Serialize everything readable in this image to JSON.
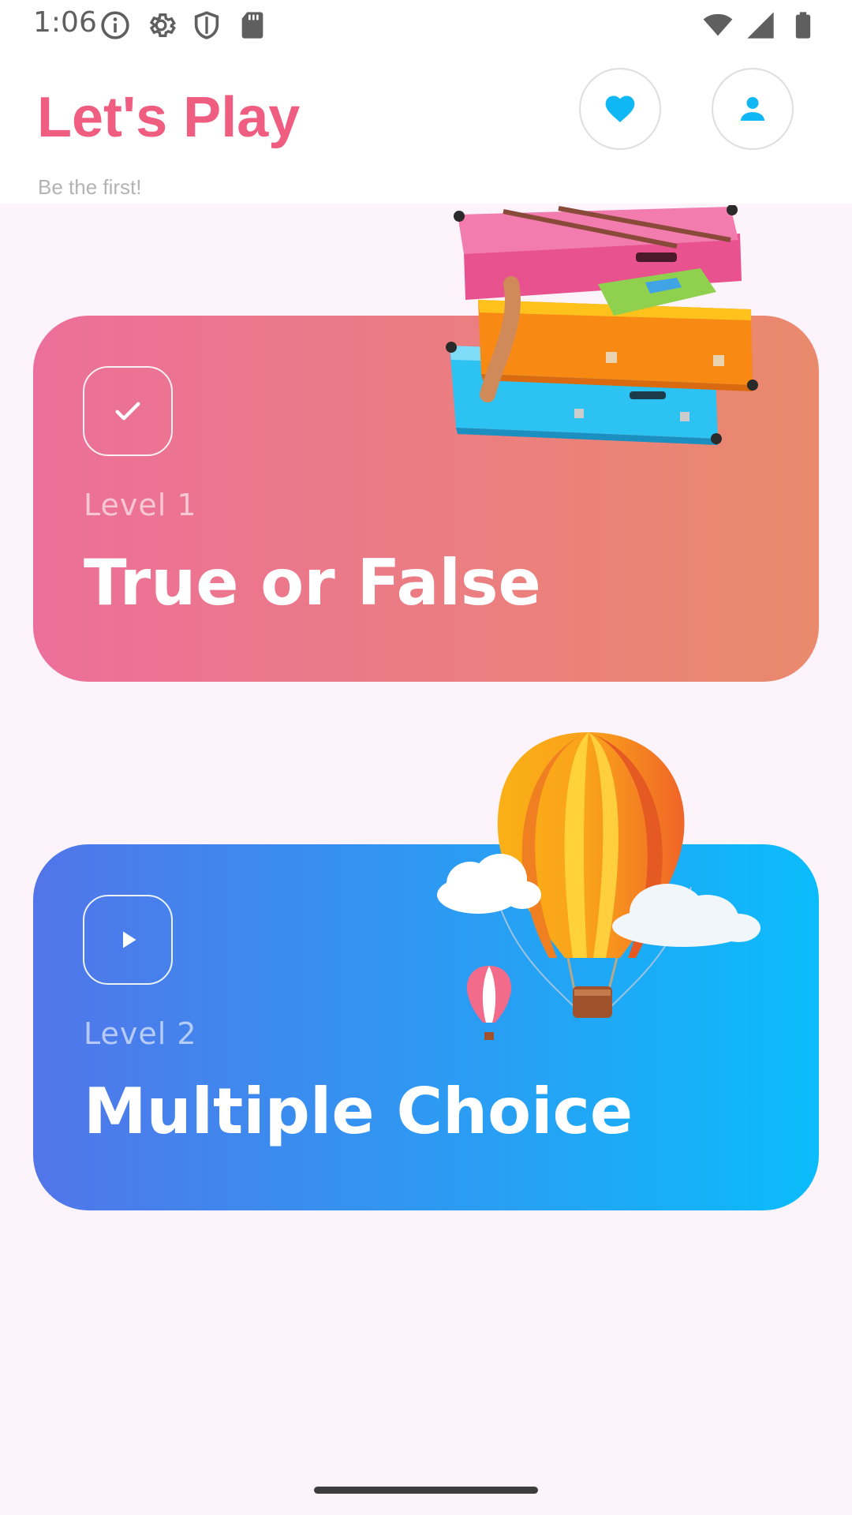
{
  "status_bar": {
    "time": "1:06",
    "left_icons": [
      "info-icon",
      "gear-icon",
      "shield-icon",
      "sd-card-icon"
    ],
    "right_icons": [
      "wifi-icon",
      "cell-signal-icon",
      "battery-icon"
    ]
  },
  "header": {
    "title": "Let's Play",
    "subtitle": "Be the first!",
    "favorites_icon": "heart-icon",
    "profile_icon": "person-icon"
  },
  "cards": [
    {
      "level": "Level 1",
      "title": "True or False",
      "icon": "check-icon",
      "gradient": [
        "#ec6f9a",
        "#ea8a6c"
      ],
      "illustration": "suitcases-illustration"
    },
    {
      "level": "Level 2",
      "title": "Multiple Choice",
      "icon": "play-icon",
      "gradient": [
        "#5275e9",
        "#0bbcfb"
      ],
      "illustration": "hot-air-balloon-illustration"
    }
  ],
  "colors": {
    "accent": "#ef5d80",
    "background": "#fcf3fb",
    "icon_blue": "#0fb7f4"
  }
}
